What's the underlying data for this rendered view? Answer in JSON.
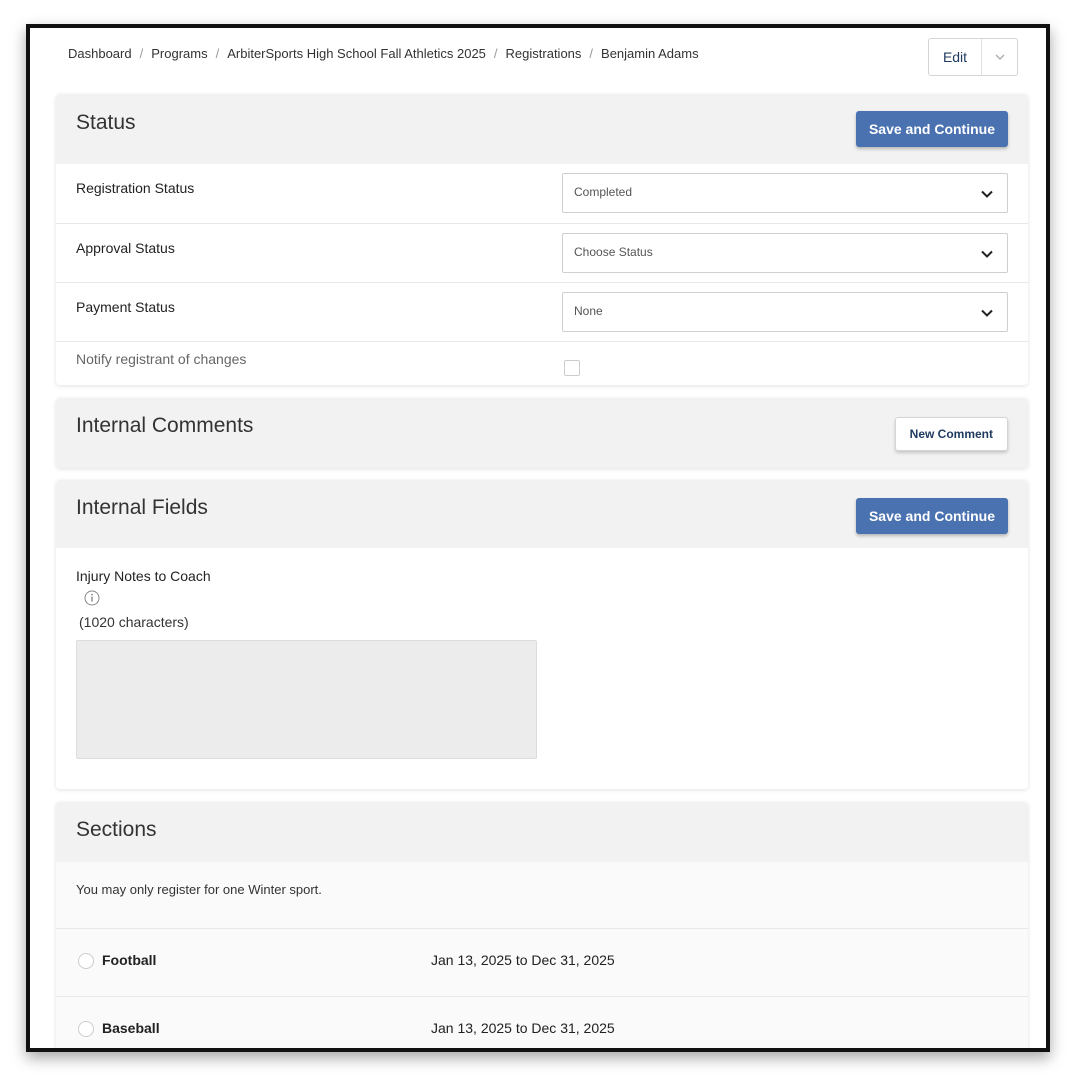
{
  "breadcrumb": [
    "Dashboard",
    "Programs",
    "ArbiterSports High School Fall Athletics 2025",
    "Registrations",
    "Benjamin Adams"
  ],
  "breadcrumb_separator": "/",
  "edit_button": {
    "label": "Edit"
  },
  "status_section": {
    "title": "Status",
    "save_label": "Save and Continue",
    "fields": [
      {
        "label": "Registration Status",
        "value": "Completed"
      },
      {
        "label": "Approval Status",
        "value": "Choose Status"
      },
      {
        "label": "Payment Status",
        "value": "None"
      }
    ],
    "notify_label": "Notify registrant of changes",
    "notify_checked": false
  },
  "comments_section": {
    "title": "Internal Comments",
    "new_comment_label": "New Comment"
  },
  "internal_fields_section": {
    "title": "Internal Fields",
    "save_label": "Save and Continue",
    "injury_label": "Injury Notes to Coach",
    "injury_limit": "(1020 characters)"
  },
  "sections_section": {
    "title": "Sections",
    "notice": "You may only register for one Winter sport.",
    "items": [
      {
        "name": "Football",
        "dates": "Jan 13, 2025 to Dec 31, 2025"
      },
      {
        "name": "Baseball",
        "dates": "Jan 13, 2025 to Dec 31, 2025"
      }
    ]
  },
  "colors": {
    "primary_button": "#4a72b0",
    "panel_header": "#f2f2f2",
    "link_dark": "#1f3a5f"
  },
  "icons": {
    "select_chevron": "chevron-down-icon",
    "edit_caret": "caret-down-icon",
    "info": "info-icon"
  }
}
